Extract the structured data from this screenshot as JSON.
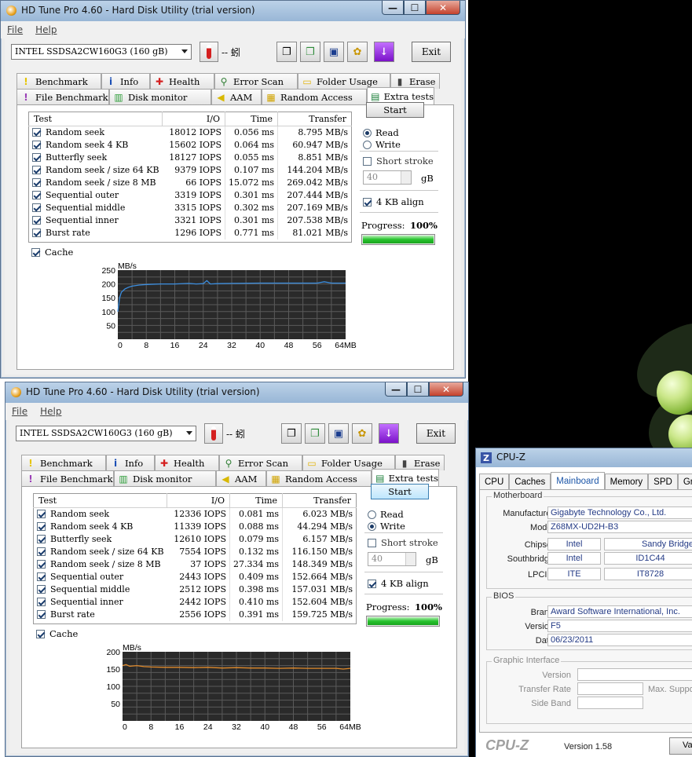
{
  "desktop": {
    "bg": "#000000"
  },
  "windows": [
    {
      "title": "HD Tune Pro 4.60 - Hard Disk Utility (trial version)",
      "menu": [
        "File",
        "Help"
      ],
      "drive": "INTEL SSDSA2CW160G3 (160 gB)",
      "temp": "-- 蚓",
      "exit": "Exit",
      "tabs_top": [
        "Benchmark",
        "Info",
        "Health",
        "Error Scan",
        "Folder Usage",
        "Erase"
      ],
      "tabs_bottom": [
        "File Benchmark",
        "Disk monitor",
        "AAM",
        "Random Access",
        "Extra tests"
      ],
      "columns": [
        "Test",
        "I/O",
        "Time",
        "Transfer"
      ],
      "rows": [
        {
          "test": "Random seek",
          "io": "18012 IOPS",
          "time": "0.056 ms",
          "transfer": "8.795 MB/s"
        },
        {
          "test": "Random seek 4 KB",
          "io": "15602 IOPS",
          "time": "0.064 ms",
          "transfer": "60.947 MB/s"
        },
        {
          "test": "Butterfly seek",
          "io": "18127 IOPS",
          "time": "0.055 ms",
          "transfer": "8.851 MB/s"
        },
        {
          "test": "Random seek / size 64 KB",
          "io": "9379 IOPS",
          "time": "0.107 ms",
          "transfer": "144.204 MB/s"
        },
        {
          "test": "Random seek / size 8 MB",
          "io": "66 IOPS",
          "time": "15.072 ms",
          "transfer": "269.042 MB/s"
        },
        {
          "test": "Sequential outer",
          "io": "3319 IOPS",
          "time": "0.301 ms",
          "transfer": "207.444 MB/s"
        },
        {
          "test": "Sequential middle",
          "io": "3315 IOPS",
          "time": "0.302 ms",
          "transfer": "207.169 MB/s"
        },
        {
          "test": "Sequential inner",
          "io": "3321 IOPS",
          "time": "0.301 ms",
          "transfer": "207.538 MB/s"
        },
        {
          "test": "Burst rate",
          "io": "1296 IOPS",
          "time": "0.771 ms",
          "transfer": "81.021 MB/s"
        }
      ],
      "cache": "Cache",
      "start": "Start",
      "read": "Read",
      "write": "Write",
      "mode": "read",
      "short_stroke": "Short stroke",
      "stroke_value": "40",
      "gb": "gB",
      "align": "4 KB align",
      "progress_label": "Progress:",
      "progress_text": "100%",
      "progress": 1.0,
      "chart_data": {
        "type": "line",
        "ylabel": "MB/s",
        "x_ticks": [
          "0",
          "8",
          "16",
          "24",
          "32",
          "40",
          "48",
          "56",
          "64MB"
        ],
        "y_ticks": [
          "250",
          "200",
          "150",
          "100",
          "50"
        ],
        "xlim": [
          0,
          64
        ],
        "ylim": [
          0,
          250
        ],
        "color": "#3b8ee0",
        "series": [
          {
            "x": [
              0,
              0.5,
              1,
              2,
              3,
              4,
              6,
              8,
              12,
              16,
              20,
              22,
              24,
              25,
              26,
              28,
              32,
              40,
              48,
              56,
              58,
              60,
              64
            ],
            "y": [
              100,
              150,
              170,
              182,
              188,
              192,
              196,
              198,
              200,
              200,
              202,
              200,
              201,
              212,
              200,
              201,
              202,
              203,
              203,
              203,
              208,
              203,
              203
            ]
          }
        ]
      }
    },
    {
      "title": "HD Tune Pro 4.60 - Hard Disk Utility (trial version)",
      "menu": [
        "File",
        "Help"
      ],
      "drive": "INTEL SSDSA2CW160G3 (160 gB)",
      "temp": "-- 蚓",
      "exit": "Exit",
      "tabs_top": [
        "Benchmark",
        "Info",
        "Health",
        "Error Scan",
        "Folder Usage",
        "Erase"
      ],
      "tabs_bottom": [
        "File Benchmark",
        "Disk monitor",
        "AAM",
        "Random Access",
        "Extra tests"
      ],
      "columns": [
        "Test",
        "I/O",
        "Time",
        "Transfer"
      ],
      "rows": [
        {
          "test": "Random seek",
          "io": "12336 IOPS",
          "time": "0.081 ms",
          "transfer": "6.023 MB/s"
        },
        {
          "test": "Random seek 4 KB",
          "io": "11339 IOPS",
          "time": "0.088 ms",
          "transfer": "44.294 MB/s"
        },
        {
          "test": "Butterfly seek",
          "io": "12610 IOPS",
          "time": "0.079 ms",
          "transfer": "6.157 MB/s"
        },
        {
          "test": "Random seek / size 64 KB",
          "io": "7554 IOPS",
          "time": "0.132 ms",
          "transfer": "116.150 MB/s"
        },
        {
          "test": "Random seek / size 8 MB",
          "io": "37 IOPS",
          "time": "27.334 ms",
          "transfer": "148.349 MB/s"
        },
        {
          "test": "Sequential outer",
          "io": "2443 IOPS",
          "time": "0.409 ms",
          "transfer": "152.664 MB/s"
        },
        {
          "test": "Sequential middle",
          "io": "2512 IOPS",
          "time": "0.398 ms",
          "transfer": "157.031 MB/s"
        },
        {
          "test": "Sequential inner",
          "io": "2442 IOPS",
          "time": "0.410 ms",
          "transfer": "152.604 MB/s"
        },
        {
          "test": "Burst rate",
          "io": "2556 IOPS",
          "time": "0.391 ms",
          "transfer": "159.725 MB/s"
        }
      ],
      "cache": "Cache",
      "start": "Start",
      "read": "Read",
      "write": "Write",
      "mode": "write",
      "short_stroke": "Short stroke",
      "stroke_value": "40",
      "gb": "gB",
      "align": "4 KB align",
      "progress_label": "Progress:",
      "progress_text": "100%",
      "progress": 1.0,
      "chart_data": {
        "type": "line",
        "ylabel": "MB/s",
        "x_ticks": [
          "0",
          "8",
          "16",
          "24",
          "32",
          "40",
          "48",
          "56",
          "64MB"
        ],
        "y_ticks": [
          "200",
          "150",
          "100",
          "50"
        ],
        "xlim": [
          0,
          64
        ],
        "ylim": [
          0,
          200
        ],
        "color": "#e08a2a",
        "series": [
          {
            "x": [
              0,
              1,
              2,
              4,
              6,
              8,
              12,
              16,
              20,
              24,
              28,
              32,
              36,
              40,
              44,
              48,
              52,
              56,
              60,
              62,
              64
            ],
            "y": [
              160,
              163,
              158,
              160,
              157,
              156,
              155,
              155,
              154,
              155,
              153,
              154,
              153,
              153,
              152,
              153,
              152,
              152,
              152,
              150,
              152
            ]
          }
        ]
      }
    }
  ],
  "cpuz": {
    "title": "CPU-Z",
    "logo": "Z",
    "tabs": [
      "CPU",
      "Caches",
      "Mainboard",
      "Memory",
      "SPD",
      "Grap"
    ],
    "active_tab": "Mainboard",
    "motherboard": {
      "group": "Motherboard",
      "manufacturer_label": "Manufacturer",
      "manufacturer": "Gigabyte Technology Co., Ltd.",
      "model_label": "Model",
      "model": "Z68MX-UD2H-B3",
      "chipset_label": "Chipset",
      "chipset_vendor": "Intel",
      "chipset_name": "Sandy Bridge",
      "southbridge_label": "Southbridge",
      "southbridge_vendor": "Intel",
      "southbridge_name": "ID1C44",
      "lpcio_label": "LPCIO",
      "lpcio_vendor": "ITE",
      "lpcio_name": "IT8728"
    },
    "bios": {
      "group": "BIOS",
      "brand_label": "Brand",
      "brand": "Award Software International, Inc.",
      "version_label": "Version",
      "version": "F5",
      "date_label": "Date",
      "date": "06/23/2011"
    },
    "graphic": {
      "group": "Graphic Interface",
      "version_label": "Version",
      "rate_label": "Transfer Rate",
      "max_label": "Max. Suppo",
      "sideband_label": "Side Band"
    },
    "footer_logo": "CPU-Z",
    "footer_version": "Version 1.58",
    "footer_button": "Va"
  }
}
